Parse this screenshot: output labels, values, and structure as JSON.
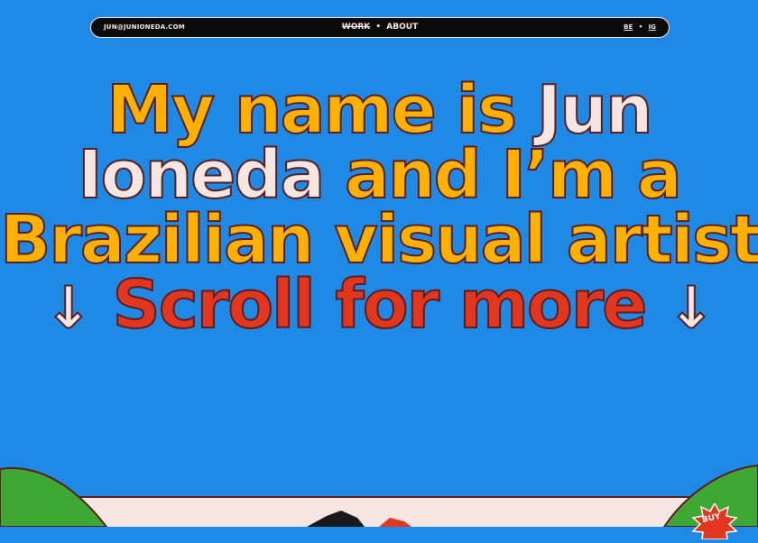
{
  "nav": {
    "email": "JUN@JUNIONEDA.COM",
    "work": "WORK",
    "dot": "•",
    "about": "ABOUT",
    "be": "BE",
    "sep": "•",
    "ig": "IG"
  },
  "hero": {
    "l1a": "My name is",
    "l1b": "Jun",
    "l2a": "Ioneda",
    "l2b": "and I’m a",
    "l3": "Brazilian visual artist.",
    "arrow_left": "↓",
    "scroll": "Scroll  for more",
    "arrow_right": "↓"
  },
  "badge": {
    "label": "BUY"
  },
  "colors": {
    "background": "#1f8ae6",
    "yellow": "#ffb000",
    "pink": "#f6e6e1",
    "red": "#e3361e",
    "green": "#3ea832"
  }
}
